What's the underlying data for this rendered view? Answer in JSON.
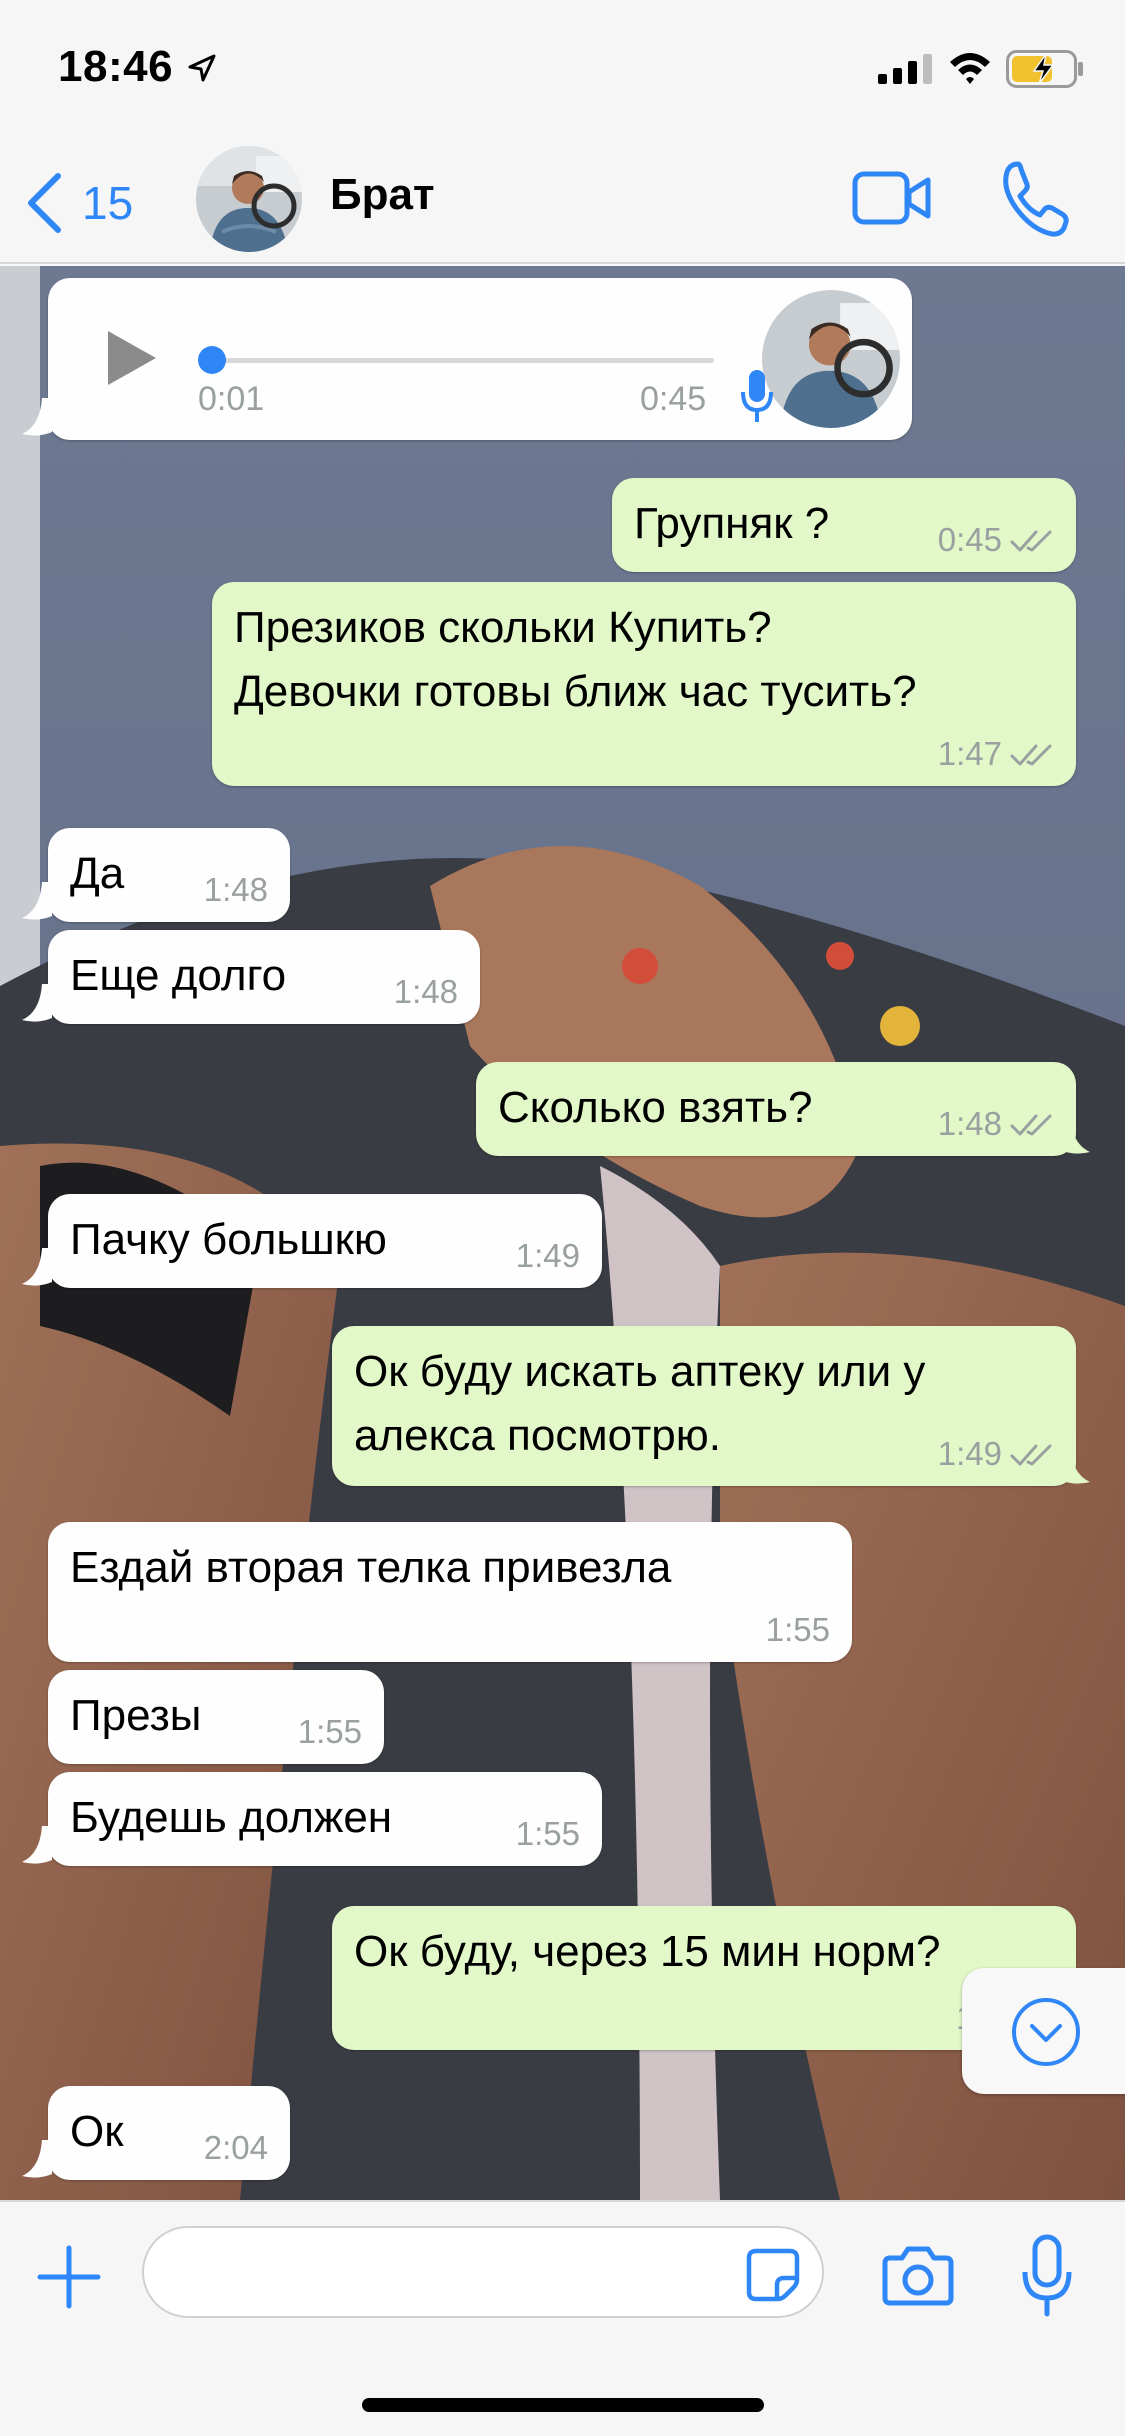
{
  "status": {
    "time": "18:46"
  },
  "header": {
    "back_count": "15",
    "contact_name": "Брат"
  },
  "voice_message": {
    "elapsed": "0:01",
    "duration": "0:45"
  },
  "messages": [
    {
      "dir": "out",
      "text": "Групняк ?",
      "time": "0:45"
    },
    {
      "dir": "out",
      "text": "Презиков скольки Купить?\nДевочки готовы ближ час тусить?",
      "time": "1:47"
    },
    {
      "dir": "in",
      "text": "Да",
      "time": "1:48"
    },
    {
      "dir": "in",
      "text": "Еще долго",
      "time": "1:48"
    },
    {
      "dir": "out",
      "text": "Сколько взять?",
      "time": "1:48"
    },
    {
      "dir": "in",
      "text": "Пачку большкю",
      "time": "1:49"
    },
    {
      "dir": "out",
      "text": "Ок буду искать аптеку или у\nалекса посмотрю.",
      "time": "1:49"
    },
    {
      "dir": "in",
      "text": "Ездай вторая телка привезла",
      "time": "1:55"
    },
    {
      "dir": "in",
      "text": "Презы",
      "time": "1:55"
    },
    {
      "dir": "in",
      "text": "Будешь должен",
      "time": "1:55"
    },
    {
      "dir": "out",
      "text": "Ок буду, через 15 мин норм?",
      "time": "1:5"
    },
    {
      "dir": "in",
      "text": "Ок",
      "time": "2:04"
    }
  ],
  "input": {
    "placeholder": ""
  },
  "colors": {
    "accent": "#2f86f6",
    "incoming_bubble": "#fefefe",
    "outgoing_bubble": "#e2f8c9",
    "read_ticks": "#9aa0a0"
  },
  "icons": {
    "location_arrow": "location-arrow-icon",
    "signal": "signal-icon",
    "wifi": "wifi-icon",
    "battery": "battery-charging-icon",
    "back": "chevron-left-icon",
    "video": "video-camera-icon",
    "phone": "phone-icon",
    "play": "play-icon",
    "mic": "microphone-icon",
    "read": "double-check-icon",
    "scroll_down": "chevron-down-circle-icon",
    "add": "plus-icon",
    "sticker": "sticker-icon",
    "camera": "camera-icon"
  }
}
